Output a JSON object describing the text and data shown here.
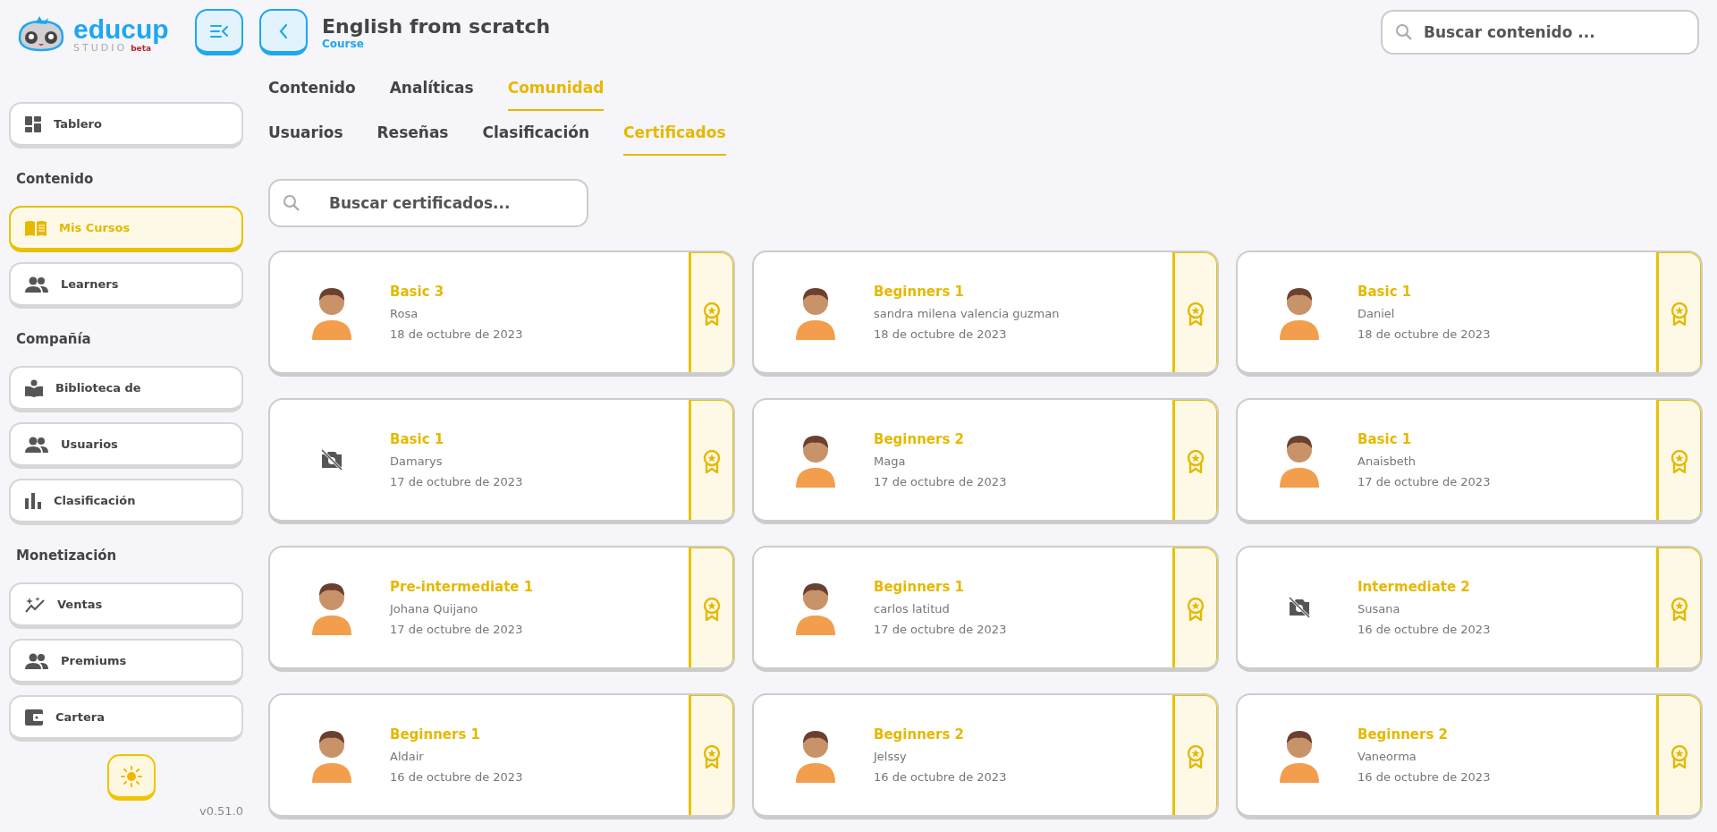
{
  "logo": {
    "name": "educup",
    "sub": "STUDIO",
    "tag": "beta"
  },
  "header": {
    "title": "English from scratch",
    "subtitle": "Course"
  },
  "search": {
    "placeholder": "Buscar contenido ..."
  },
  "tabs": [
    {
      "label": "Contenido",
      "selected": false
    },
    {
      "label": "Analíticas",
      "selected": false
    },
    {
      "label": "Comunidad",
      "selected": true
    }
  ],
  "subtabs": [
    {
      "label": "Usuarios",
      "selected": false
    },
    {
      "label": "Reseñas",
      "selected": false
    },
    {
      "label": "Clasificación",
      "selected": false
    },
    {
      "label": "Certificados",
      "selected": true
    }
  ],
  "certificate_search": {
    "placeholder": "Buscar certificados..."
  },
  "sidebar": {
    "items": [
      {
        "kind": "dashboard",
        "label": "Tablero",
        "selected": false
      },
      {
        "kind": "section",
        "label": "Contenido"
      },
      {
        "kind": "book",
        "label": "Mis Cursos",
        "selected": true
      },
      {
        "kind": "people",
        "label": "Learners",
        "selected": false
      },
      {
        "kind": "section",
        "label": "Compañía"
      },
      {
        "kind": "reader",
        "label": "Biblioteca de",
        "selected": false
      },
      {
        "kind": "people",
        "label": "Usuarios",
        "selected": false
      },
      {
        "kind": "bars",
        "label": "Clasificación",
        "selected": false
      },
      {
        "kind": "section",
        "label": "Monetización"
      },
      {
        "kind": "sparkle",
        "label": "Ventas",
        "selected": false
      },
      {
        "kind": "people",
        "label": "Premiums",
        "selected": false
      },
      {
        "kind": "wallet",
        "label": "Cartera",
        "selected": false
      }
    ],
    "version": "v0.51.0"
  },
  "certificates": [
    {
      "kind": "avatar",
      "course": "Basic 3",
      "learner": "Rosa",
      "date": "18 de octubre de 2023"
    },
    {
      "kind": "avatar",
      "course": "Beginners 1",
      "learner": "sandra milena valencia guzman",
      "date": "18 de octubre de 2023"
    },
    {
      "kind": "avatar",
      "course": "Basic 1",
      "learner": "Daniel",
      "date": "18 de octubre de 2023"
    },
    {
      "kind": "no-photo",
      "course": "Basic 1",
      "learner": "Damarys",
      "date": "17 de octubre de 2023"
    },
    {
      "kind": "avatar",
      "course": "Beginners 2",
      "learner": "Maga",
      "date": "17 de octubre de 2023"
    },
    {
      "kind": "avatar",
      "course": "Basic 1",
      "learner": "Anaisbeth",
      "date": "17 de octubre de 2023"
    },
    {
      "kind": "avatar",
      "course": "Pre-intermediate 1",
      "learner": "Johana Quijano",
      "date": "17 de octubre de 2023"
    },
    {
      "kind": "avatar",
      "course": "Beginners 1",
      "learner": "carlos latitud",
      "date": "17 de octubre de 2023"
    },
    {
      "kind": "no-photo",
      "course": "Intermediate 2",
      "learner": "Susana",
      "date": "16 de octubre de 2023"
    },
    {
      "kind": "avatar",
      "course": "Beginners 1",
      "learner": "Aldair",
      "date": "16 de octubre de 2023"
    },
    {
      "kind": "avatar",
      "course": "Beginners 2",
      "learner": "Jelssy",
      "date": "16 de octubre de 2023"
    },
    {
      "kind": "avatar",
      "course": "Beginners 2",
      "learner": "Vaneorma",
      "date": "16 de octubre de 2023"
    }
  ]
}
